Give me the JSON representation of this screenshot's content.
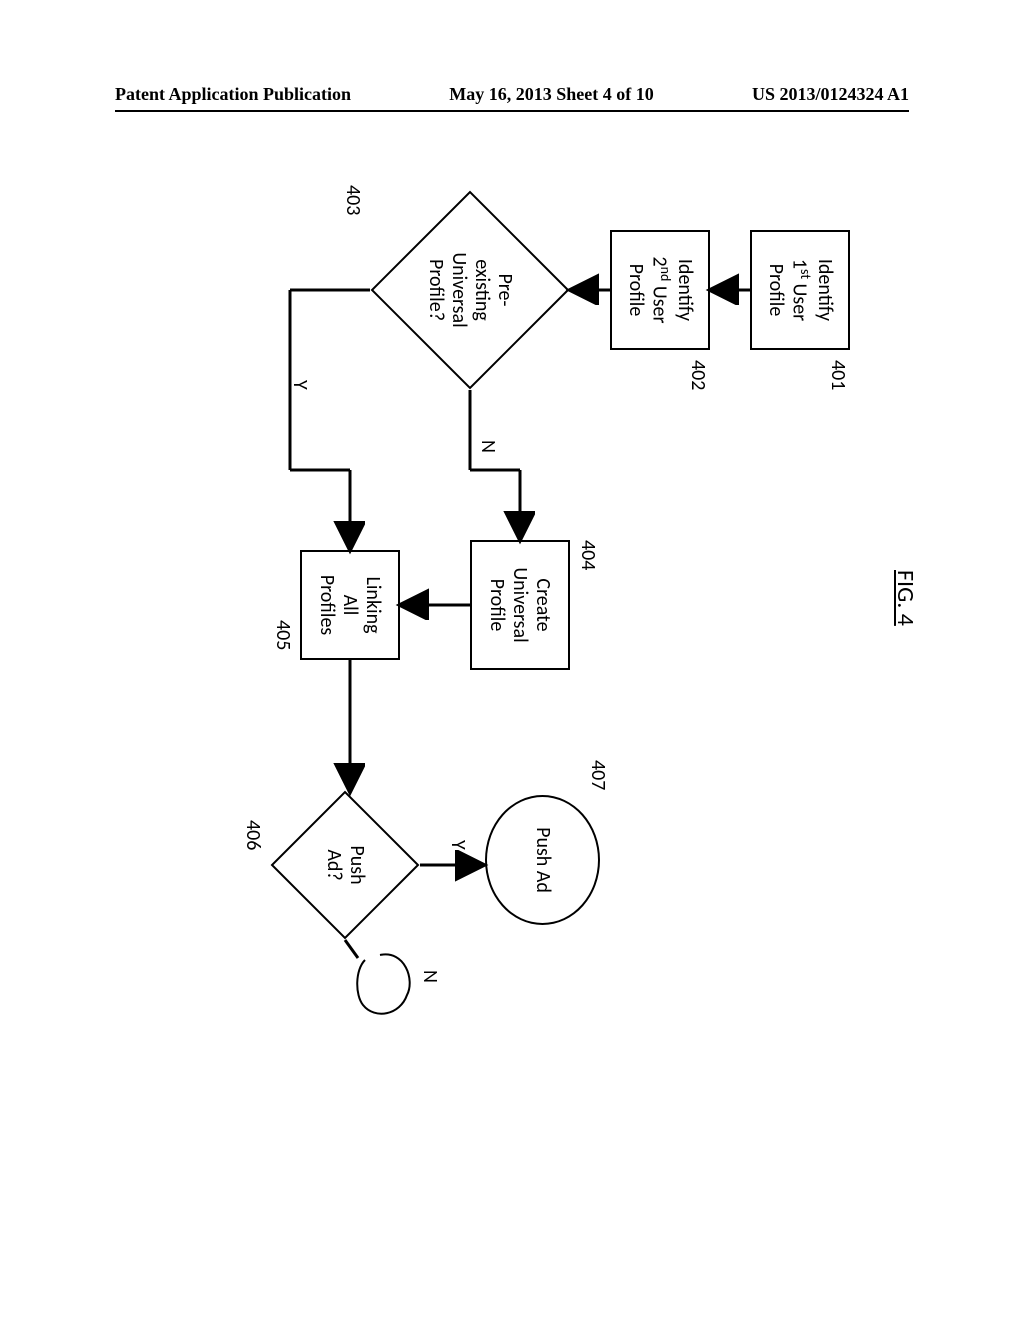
{
  "header": {
    "left": "Patent Application Publication",
    "center": "May 16, 2013  Sheet 4 of 10",
    "right": "US 2013/0124324 A1"
  },
  "figure": {
    "title": "FIG. 4"
  },
  "nodes": {
    "n401": {
      "ref": "401",
      "text": "Identify 1st User Profile"
    },
    "n402": {
      "ref": "402",
      "text": "Identify 2nd User Profile"
    },
    "n403": {
      "ref": "403",
      "text": "Pre-existing Universal Profile?"
    },
    "n404": {
      "ref": "404",
      "text": "Create Universal Profile"
    },
    "n405": {
      "ref": "405",
      "text": "Linking All Profiles"
    },
    "n406": {
      "ref": "406",
      "text": "Push Ad?"
    },
    "n407": {
      "ref": "407",
      "text": "Push Ad"
    }
  },
  "edges": {
    "y": "Y",
    "n": "N"
  }
}
